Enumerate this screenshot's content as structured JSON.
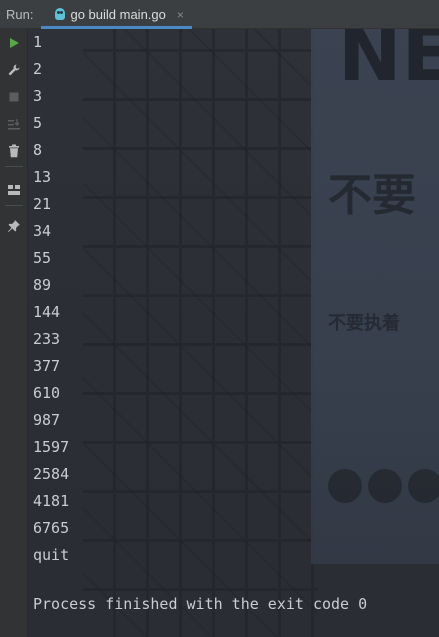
{
  "header": {
    "run_label": "Run:",
    "tab_label": "go build main.go",
    "close_glyph": "×"
  },
  "toolbar": {
    "icons": [
      "play-icon",
      "wrench-icon",
      "stop-icon",
      "sort-icon",
      "trash-icon",
      "layout-icon",
      "pin-icon"
    ]
  },
  "background": {
    "billboard_big": "NE",
    "billboard_line1": "不要",
    "billboard_line2": "不要执着"
  },
  "console": {
    "lines": [
      "1",
      "2",
      "3",
      "5",
      "8",
      "13",
      "21",
      "34",
      "55",
      "89",
      "144",
      "233",
      "377",
      "610",
      "987",
      "1597",
      "2584",
      "4181",
      "6765",
      "quit"
    ],
    "exit_message": "Process finished with the exit code 0"
  },
  "colors": {
    "run_green": "#57a64a",
    "tab_underline": "#4a88c7"
  }
}
